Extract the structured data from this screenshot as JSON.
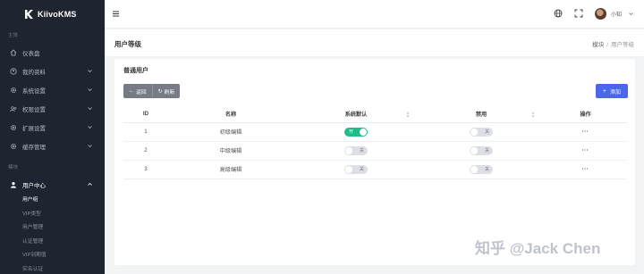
{
  "app": {
    "name": "KiivoKMS"
  },
  "sidebar": {
    "section_main": "主体",
    "items": [
      {
        "label": "仪表盘",
        "icon": "home-icon"
      },
      {
        "label": "我的资料",
        "icon": "user-circle-icon"
      },
      {
        "label": "系统设置",
        "icon": "gear-icon"
      },
      {
        "label": "权限设置",
        "icon": "users-icon"
      },
      {
        "label": "扩展设置",
        "icon": "gear-icon"
      },
      {
        "label": "缓存管理",
        "icon": "gear-icon"
      }
    ],
    "section_module": "模块",
    "user_center": {
      "label": "用户中心",
      "icon": "user-icon"
    },
    "sub_items": [
      "用户组",
      "VIP类型",
      "用户管理",
      "认证管理",
      "VIP到期值",
      "实名认证"
    ]
  },
  "header": {
    "username": "小知"
  },
  "titlebar": {
    "title": "用户等级",
    "breadcrumb": [
      "模块",
      "用户等级"
    ]
  },
  "card": {
    "title": "普通用户",
    "btn_back": "返回",
    "btn_refresh": "刷新",
    "btn_add": "添加"
  },
  "table": {
    "headers": [
      "ID",
      "名称",
      "系统默认",
      "禁用",
      "操作"
    ],
    "rows": [
      {
        "id": "1",
        "name": "初级编辑",
        "default": "开",
        "disabled": "关",
        "op": "···"
      },
      {
        "id": "2",
        "name": "中级编辑",
        "default": "关",
        "disabled": "关",
        "op": "···"
      },
      {
        "id": "3",
        "name": "高级编辑",
        "default": "关",
        "disabled": "关",
        "op": "···"
      }
    ]
  },
  "watermark": "知乎 @Jack Chen",
  "colors": {
    "sidebar_bg": "#1f2431",
    "accent": "#4b66e8",
    "toggle_on": "#21ba8b"
  }
}
